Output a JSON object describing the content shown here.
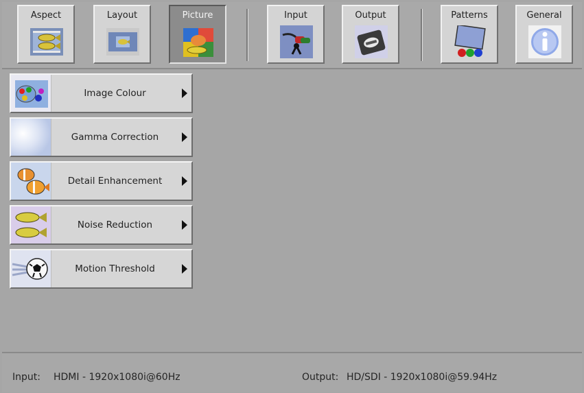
{
  "toolbar": {
    "buttons": [
      {
        "label": "Aspect",
        "icon": "aspect-icon",
        "active": false
      },
      {
        "label": "Layout",
        "icon": "layout-icon",
        "active": false
      },
      {
        "label": "Picture",
        "icon": "picture-icon",
        "active": true
      },
      {
        "label": "Input",
        "icon": "input-icon",
        "active": false
      },
      {
        "label": "Output",
        "icon": "output-icon",
        "active": false
      },
      {
        "label": "Patterns",
        "icon": "patterns-icon",
        "active": false
      },
      {
        "label": "General",
        "icon": "general-info-icon",
        "active": false
      }
    ]
  },
  "menu": {
    "items": [
      {
        "label": "Image Colour",
        "icon": "image-colour-icon"
      },
      {
        "label": "Gamma Correction",
        "icon": "gamma-correction-icon"
      },
      {
        "label": "Detail Enhancement",
        "icon": "detail-enhancement-icon"
      },
      {
        "label": "Noise Reduction",
        "icon": "noise-reduction-icon"
      },
      {
        "label": "Motion Threshold",
        "icon": "motion-threshold-icon"
      }
    ]
  },
  "status": {
    "input_label": "Input:",
    "input_value": "HDMI - 1920x1080i@60Hz",
    "output_label": "Output:",
    "output_value": "HD/SDI - 1920x1080i@59.94Hz"
  },
  "colors": {
    "background": "#a6a6a6",
    "button_face": "#d4d4d4",
    "active_button": "#8c8c8c"
  }
}
